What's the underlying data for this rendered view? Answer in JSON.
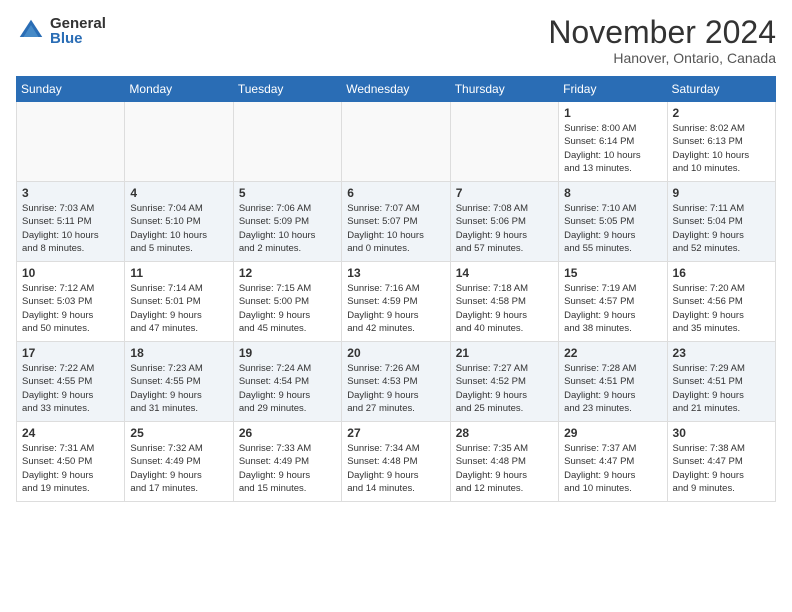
{
  "header": {
    "logo_general": "General",
    "logo_blue": "Blue",
    "month_title": "November 2024",
    "location": "Hanover, Ontario, Canada"
  },
  "days_of_week": [
    "Sunday",
    "Monday",
    "Tuesday",
    "Wednesday",
    "Thursday",
    "Friday",
    "Saturday"
  ],
  "weeks": [
    [
      {
        "day": "",
        "info": ""
      },
      {
        "day": "",
        "info": ""
      },
      {
        "day": "",
        "info": ""
      },
      {
        "day": "",
        "info": ""
      },
      {
        "day": "",
        "info": ""
      },
      {
        "day": "1",
        "info": "Sunrise: 8:00 AM\nSunset: 6:14 PM\nDaylight: 10 hours\nand 13 minutes."
      },
      {
        "day": "2",
        "info": "Sunrise: 8:02 AM\nSunset: 6:13 PM\nDaylight: 10 hours\nand 10 minutes."
      }
    ],
    [
      {
        "day": "3",
        "info": "Sunrise: 7:03 AM\nSunset: 5:11 PM\nDaylight: 10 hours\nand 8 minutes."
      },
      {
        "day": "4",
        "info": "Sunrise: 7:04 AM\nSunset: 5:10 PM\nDaylight: 10 hours\nand 5 minutes."
      },
      {
        "day": "5",
        "info": "Sunrise: 7:06 AM\nSunset: 5:09 PM\nDaylight: 10 hours\nand 2 minutes."
      },
      {
        "day": "6",
        "info": "Sunrise: 7:07 AM\nSunset: 5:07 PM\nDaylight: 10 hours\nand 0 minutes."
      },
      {
        "day": "7",
        "info": "Sunrise: 7:08 AM\nSunset: 5:06 PM\nDaylight: 9 hours\nand 57 minutes."
      },
      {
        "day": "8",
        "info": "Sunrise: 7:10 AM\nSunset: 5:05 PM\nDaylight: 9 hours\nand 55 minutes."
      },
      {
        "day": "9",
        "info": "Sunrise: 7:11 AM\nSunset: 5:04 PM\nDaylight: 9 hours\nand 52 minutes."
      }
    ],
    [
      {
        "day": "10",
        "info": "Sunrise: 7:12 AM\nSunset: 5:03 PM\nDaylight: 9 hours\nand 50 minutes."
      },
      {
        "day": "11",
        "info": "Sunrise: 7:14 AM\nSunset: 5:01 PM\nDaylight: 9 hours\nand 47 minutes."
      },
      {
        "day": "12",
        "info": "Sunrise: 7:15 AM\nSunset: 5:00 PM\nDaylight: 9 hours\nand 45 minutes."
      },
      {
        "day": "13",
        "info": "Sunrise: 7:16 AM\nSunset: 4:59 PM\nDaylight: 9 hours\nand 42 minutes."
      },
      {
        "day": "14",
        "info": "Sunrise: 7:18 AM\nSunset: 4:58 PM\nDaylight: 9 hours\nand 40 minutes."
      },
      {
        "day": "15",
        "info": "Sunrise: 7:19 AM\nSunset: 4:57 PM\nDaylight: 9 hours\nand 38 minutes."
      },
      {
        "day": "16",
        "info": "Sunrise: 7:20 AM\nSunset: 4:56 PM\nDaylight: 9 hours\nand 35 minutes."
      }
    ],
    [
      {
        "day": "17",
        "info": "Sunrise: 7:22 AM\nSunset: 4:55 PM\nDaylight: 9 hours\nand 33 minutes."
      },
      {
        "day": "18",
        "info": "Sunrise: 7:23 AM\nSunset: 4:55 PM\nDaylight: 9 hours\nand 31 minutes."
      },
      {
        "day": "19",
        "info": "Sunrise: 7:24 AM\nSunset: 4:54 PM\nDaylight: 9 hours\nand 29 minutes."
      },
      {
        "day": "20",
        "info": "Sunrise: 7:26 AM\nSunset: 4:53 PM\nDaylight: 9 hours\nand 27 minutes."
      },
      {
        "day": "21",
        "info": "Sunrise: 7:27 AM\nSunset: 4:52 PM\nDaylight: 9 hours\nand 25 minutes."
      },
      {
        "day": "22",
        "info": "Sunrise: 7:28 AM\nSunset: 4:51 PM\nDaylight: 9 hours\nand 23 minutes."
      },
      {
        "day": "23",
        "info": "Sunrise: 7:29 AM\nSunset: 4:51 PM\nDaylight: 9 hours\nand 21 minutes."
      }
    ],
    [
      {
        "day": "24",
        "info": "Sunrise: 7:31 AM\nSunset: 4:50 PM\nDaylight: 9 hours\nand 19 minutes."
      },
      {
        "day": "25",
        "info": "Sunrise: 7:32 AM\nSunset: 4:49 PM\nDaylight: 9 hours\nand 17 minutes."
      },
      {
        "day": "26",
        "info": "Sunrise: 7:33 AM\nSunset: 4:49 PM\nDaylight: 9 hours\nand 15 minutes."
      },
      {
        "day": "27",
        "info": "Sunrise: 7:34 AM\nSunset: 4:48 PM\nDaylight: 9 hours\nand 14 minutes."
      },
      {
        "day": "28",
        "info": "Sunrise: 7:35 AM\nSunset: 4:48 PM\nDaylight: 9 hours\nand 12 minutes."
      },
      {
        "day": "29",
        "info": "Sunrise: 7:37 AM\nSunset: 4:47 PM\nDaylight: 9 hours\nand 10 minutes."
      },
      {
        "day": "30",
        "info": "Sunrise: 7:38 AM\nSunset: 4:47 PM\nDaylight: 9 hours\nand 9 minutes."
      }
    ]
  ]
}
